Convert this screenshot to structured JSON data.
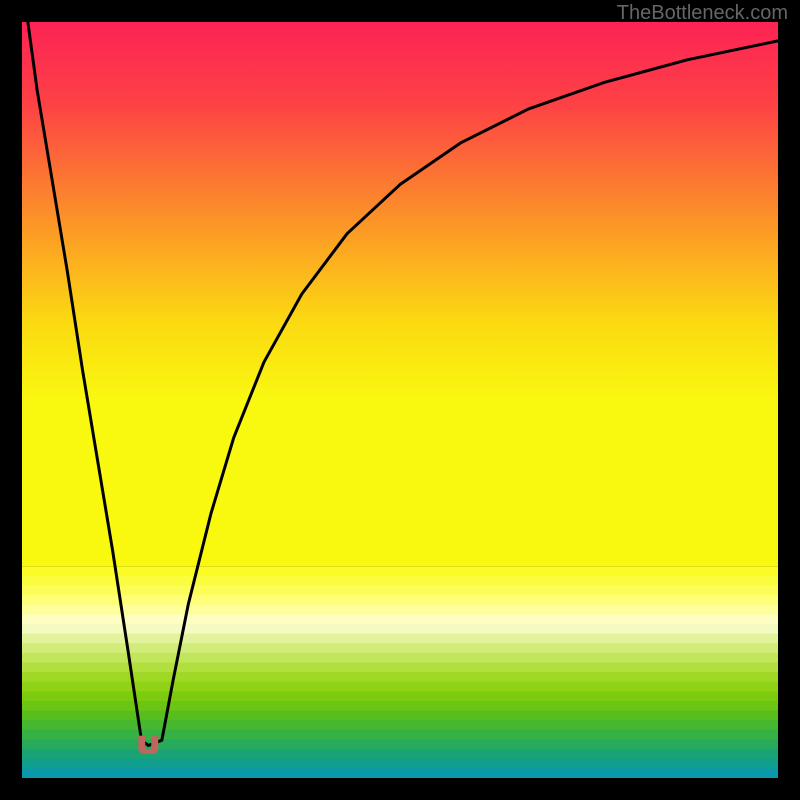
{
  "watermark": {
    "text": "TheBottleneck.com"
  },
  "chart_data": {
    "type": "line",
    "title": "",
    "xlabel": "",
    "ylabel": "",
    "xlim": [
      0,
      100
    ],
    "ylim": [
      0,
      100
    ],
    "grid": false,
    "series": [
      {
        "name": "bottleneck-curve",
        "x": [
          0.5,
          2,
          4,
          6,
          8,
          10,
          12,
          14,
          15.8,
          16.7,
          18.5,
          20,
          22,
          25,
          28,
          32,
          37,
          43,
          50,
          58,
          67,
          77,
          88,
          100
        ],
        "y": [
          102,
          91,
          79,
          67,
          54,
          42,
          30,
          17,
          5,
          4.3,
          5,
          13,
          23,
          35,
          45,
          55,
          64,
          72,
          78.5,
          84,
          88.5,
          92,
          95,
          97.5
        ]
      }
    ],
    "marker": {
      "x": 16.7,
      "y": 4.3,
      "color": "#c1665c"
    },
    "background": {
      "bands_top": 72,
      "gradient_stops": [
        {
          "pct": 0,
          "color": "#fd2355"
        },
        {
          "pct": 15,
          "color": "#fd4145"
        },
        {
          "pct": 35,
          "color": "#fc8e2a"
        },
        {
          "pct": 55,
          "color": "#fbd911"
        },
        {
          "pct": 70,
          "color": "#f9f910"
        },
        {
          "pct": 72,
          "color": "#f9f910"
        }
      ],
      "bands": [
        "#fbfb25",
        "#fcfc3f",
        "#fdfd59",
        "#fefe79",
        "#fefe9d",
        "#fefec2",
        "#f4fac0",
        "#e3f39c",
        "#d2ec79",
        "#c2e659",
        "#b1df3d",
        "#a0d826",
        "#8fd216",
        "#7dcb0f",
        "#6bc512",
        "#58be1d",
        "#46b72f",
        "#36b144",
        "#27aa5c",
        "#1aa475",
        "#109e8f",
        "#0b98a8"
      ]
    }
  }
}
